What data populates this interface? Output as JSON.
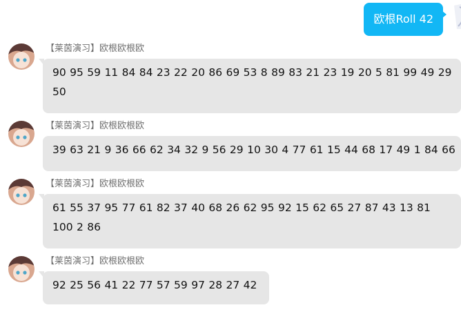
{
  "outgoing": {
    "text": "欧根Roll 42"
  },
  "messages": [
    {
      "sender": "【莱茵演习】欧根欧根欧",
      "text": "90 95 59 11 84 84 23 22 20 86 69 53 8 89 83 21 23 19 20 5 81 99 49 29 50"
    },
    {
      "sender": "【莱茵演习】欧根欧根欧",
      "text": "39 63 21 9 36 66 62 34 32 9 56 29 10 30 4 77 61 15 44 68 17 49 1 84 66"
    },
    {
      "sender": "【莱茵演习】欧根欧根欧",
      "text": "61 55 37 95 77 61 82 37 40 68 26 62 95 92 15 62 65 27 87 43 13 81 100 2 86"
    },
    {
      "sender": "【莱茵演习】欧根欧根欧",
      "text": "92 25 56 41 22 77 57 59 97 28 27 42"
    }
  ]
}
